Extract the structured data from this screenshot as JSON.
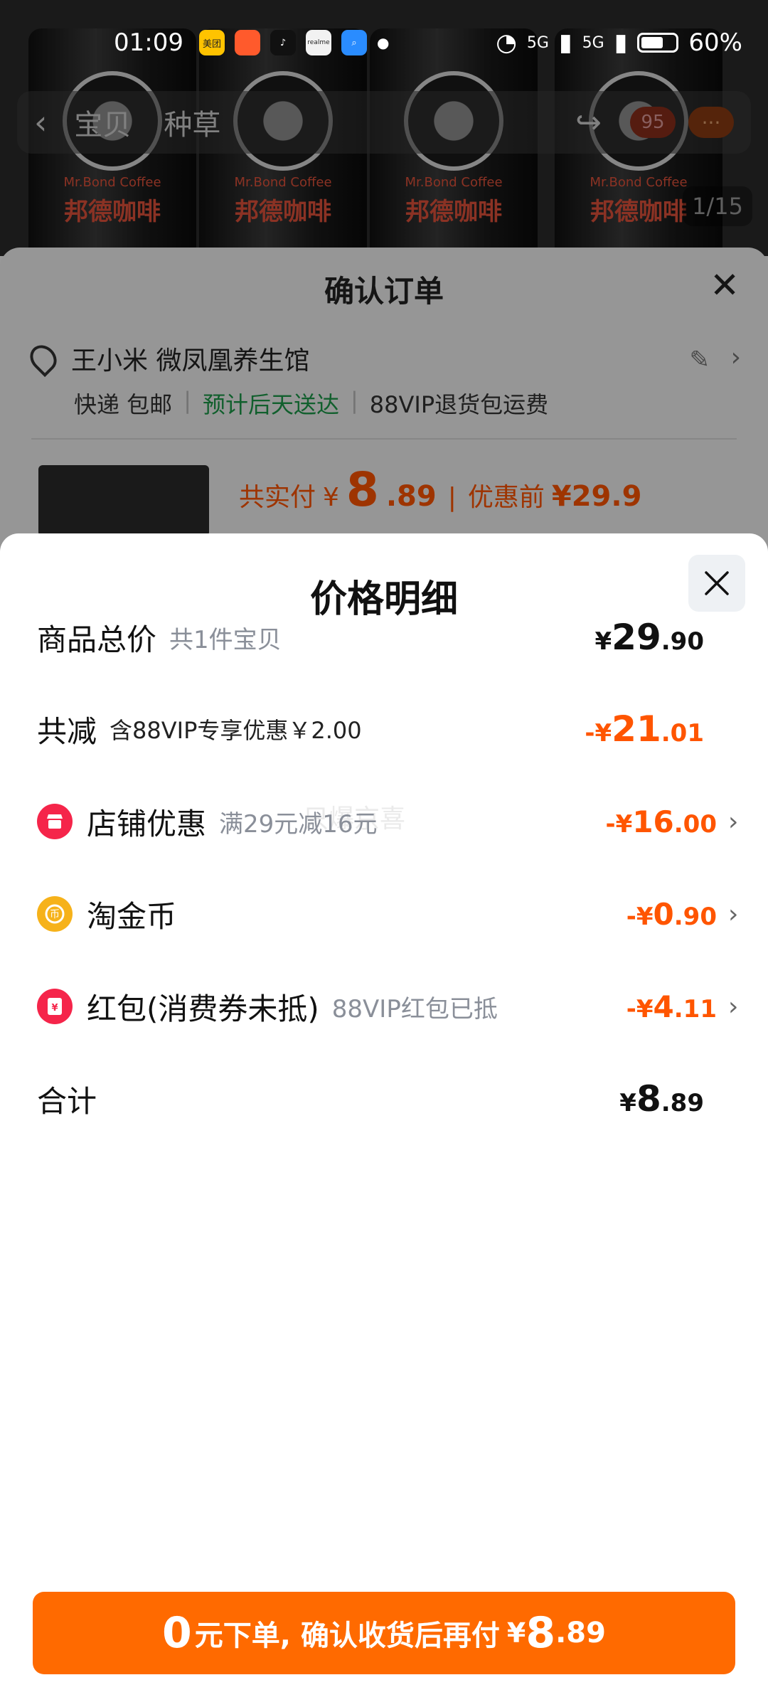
{
  "statusbar": {
    "time": "01:09",
    "apps": [
      {
        "icon": "meituan-icon",
        "label": "美团",
        "color": "#ffc300"
      },
      {
        "icon": "app-icon",
        "label": "",
        "color": "#ff5a2c"
      },
      {
        "icon": "tiktok-icon",
        "label": "",
        "color": "#111111"
      },
      {
        "icon": "realme-icon",
        "label": "realme",
        "color": "#f2f2f2"
      },
      {
        "icon": "search-app-icon",
        "label": "",
        "color": "#2a8cff"
      }
    ],
    "net1": "5G",
    "net2": "5G",
    "battery": "60%"
  },
  "product": {
    "nav_tabs": [
      "宝贝",
      "种草"
    ],
    "cart_badge": "95",
    "image_counter": "1/15",
    "brand": "邦德咖啡",
    "brand_en": "Mr.Bond Coffee"
  },
  "order": {
    "title": "确认订单",
    "recipient": "王小米 微凤凰养生馆",
    "ship_method": "快递 包邮",
    "delivery": "预计后天送达",
    "return_note": "88VIP退货包运费",
    "paid_label": "共实付",
    "paid_currency": "¥",
    "paid_int": "8",
    "paid_dec": ".89",
    "before_label": "优惠前",
    "before_value": "¥29.9"
  },
  "price_detail": {
    "title": "价格明细",
    "watermark": "只爆京喜",
    "rows": {
      "goods": {
        "label": "商品总价",
        "sub": "共1件宝贝",
        "cur": "¥",
        "int": "29",
        "dec": ".90"
      },
      "reduce": {
        "label": "共减",
        "sub": "含88VIP专享优惠￥2.00",
        "cur": "-¥",
        "int": "21",
        "dec": ".01"
      },
      "shop": {
        "label": "店铺优惠",
        "sub": "满29元减16元",
        "cur": "-¥",
        "int": "16",
        "dec": ".00"
      },
      "coin": {
        "label": "淘金币",
        "sub": "",
        "cur": "-¥",
        "int": "0",
        "dec": ".90"
      },
      "redpacket": {
        "label": "红包(消费券未抵)",
        "sub": "88VIP红包已抵",
        "cur": "-¥",
        "int": "4",
        "dec": ".11"
      },
      "total": {
        "label": "合计",
        "cur": "¥",
        "int": "8",
        "dec": ".89"
      }
    }
  },
  "cta": {
    "n1": "0",
    "text": "元下单, 确认收货后再付",
    "cur": "¥",
    "int": "8",
    "dec": ".89"
  },
  "colors": {
    "accent": "#ff6a00",
    "discount": "#ff5500",
    "green": "#1c9a4a",
    "shop_icon": "#f5254a",
    "coin_icon": "#f6b21a"
  }
}
